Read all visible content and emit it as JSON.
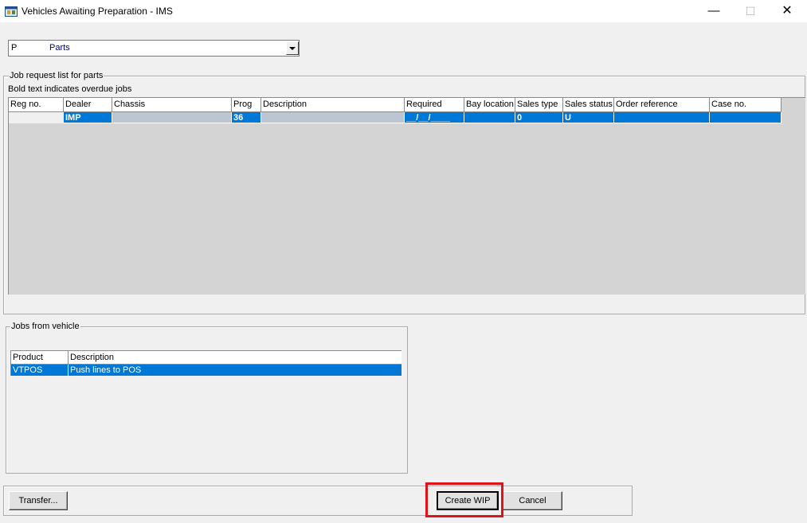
{
  "window": {
    "title": "Vehicles Awaiting Preparation - IMS",
    "minimize_glyph": "—",
    "maximize_glyph": "☐",
    "close_glyph": "✕"
  },
  "department_combo": {
    "code": "P",
    "label": "Parts",
    "icon": "chevron-down-icon"
  },
  "job_request": {
    "group_title": "Job request list for parts",
    "note": "Bold text indicates overdue jobs",
    "columns": [
      "Reg no.",
      "Dealer",
      "Chassis",
      "Prog",
      "Description",
      "Required",
      "Bay location",
      "Sales type",
      "Sales status",
      "Order reference",
      "Case no."
    ],
    "rows": [
      {
        "reg_no": "",
        "dealer": "IMP",
        "chassis": "",
        "prog": "36",
        "description": "",
        "required": "__/__/____",
        "bay_location": "",
        "sales_type": "0",
        "sales_status": "U",
        "order_reference": "",
        "case_no": ""
      }
    ]
  },
  "jobs_from_vehicle": {
    "group_title": "Jobs from vehicle",
    "columns": [
      "Product",
      "Description"
    ],
    "rows": [
      {
        "product": "VTPOS",
        "description": "Push lines to POS"
      }
    ]
  },
  "buttons": {
    "transfer": "Transfer...",
    "create_wip": "Create WIP",
    "cancel": "Cancel"
  },
  "colors": {
    "selection": "#0078d7",
    "highlight_box": "#e0121a",
    "combo_label": "#000080"
  }
}
